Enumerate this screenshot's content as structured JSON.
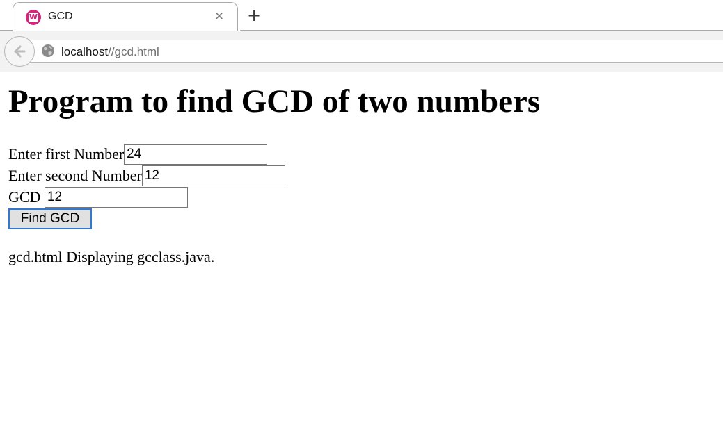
{
  "browser": {
    "tab": {
      "title": "GCD",
      "favicon_letter": "W",
      "close_glyph": "✕",
      "favicon_color": "#d8237e"
    },
    "new_tab_glyph": "+",
    "url": {
      "host": "localhost",
      "path": "//gcd.html"
    }
  },
  "page": {
    "title": "Program to find GCD of two numbers",
    "form": {
      "first_label": "Enter first Number",
      "first_value": "24",
      "second_label": "Enter second Number",
      "second_value": "12",
      "result_label": "GCD ",
      "result_value": "12",
      "button_label": "Find GCD"
    },
    "footer": "gcd.html Displaying gcclass.java."
  }
}
